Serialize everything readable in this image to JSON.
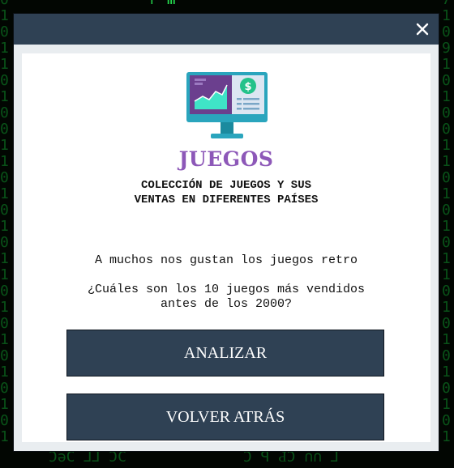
{
  "window": {
    "close_icon": "close-icon"
  },
  "content": {
    "logo_icon": "monitor-chart-dollar-icon",
    "title": "JUEGOS",
    "subtitle": "COLECCIÓN DE JUEGOS Y SUS\nVENTAS EN DIFERENTES PAÍSES",
    "text_1": "A muchos nos gustan los juegos retro",
    "text_2": "¿Cuáles son los 10 juegos más vendidos\nantes de los 2000?"
  },
  "buttons": {
    "analyze_label": "ANALIZAR",
    "back_label": "VOLVER ATRÁS"
  },
  "colors": {
    "header_bg": "#2f4154",
    "button_bg": "#2f4154",
    "title_color": "#8d58b8",
    "modal_bg": "#e9edf0",
    "matrix_green": "#0f8f2a"
  }
}
